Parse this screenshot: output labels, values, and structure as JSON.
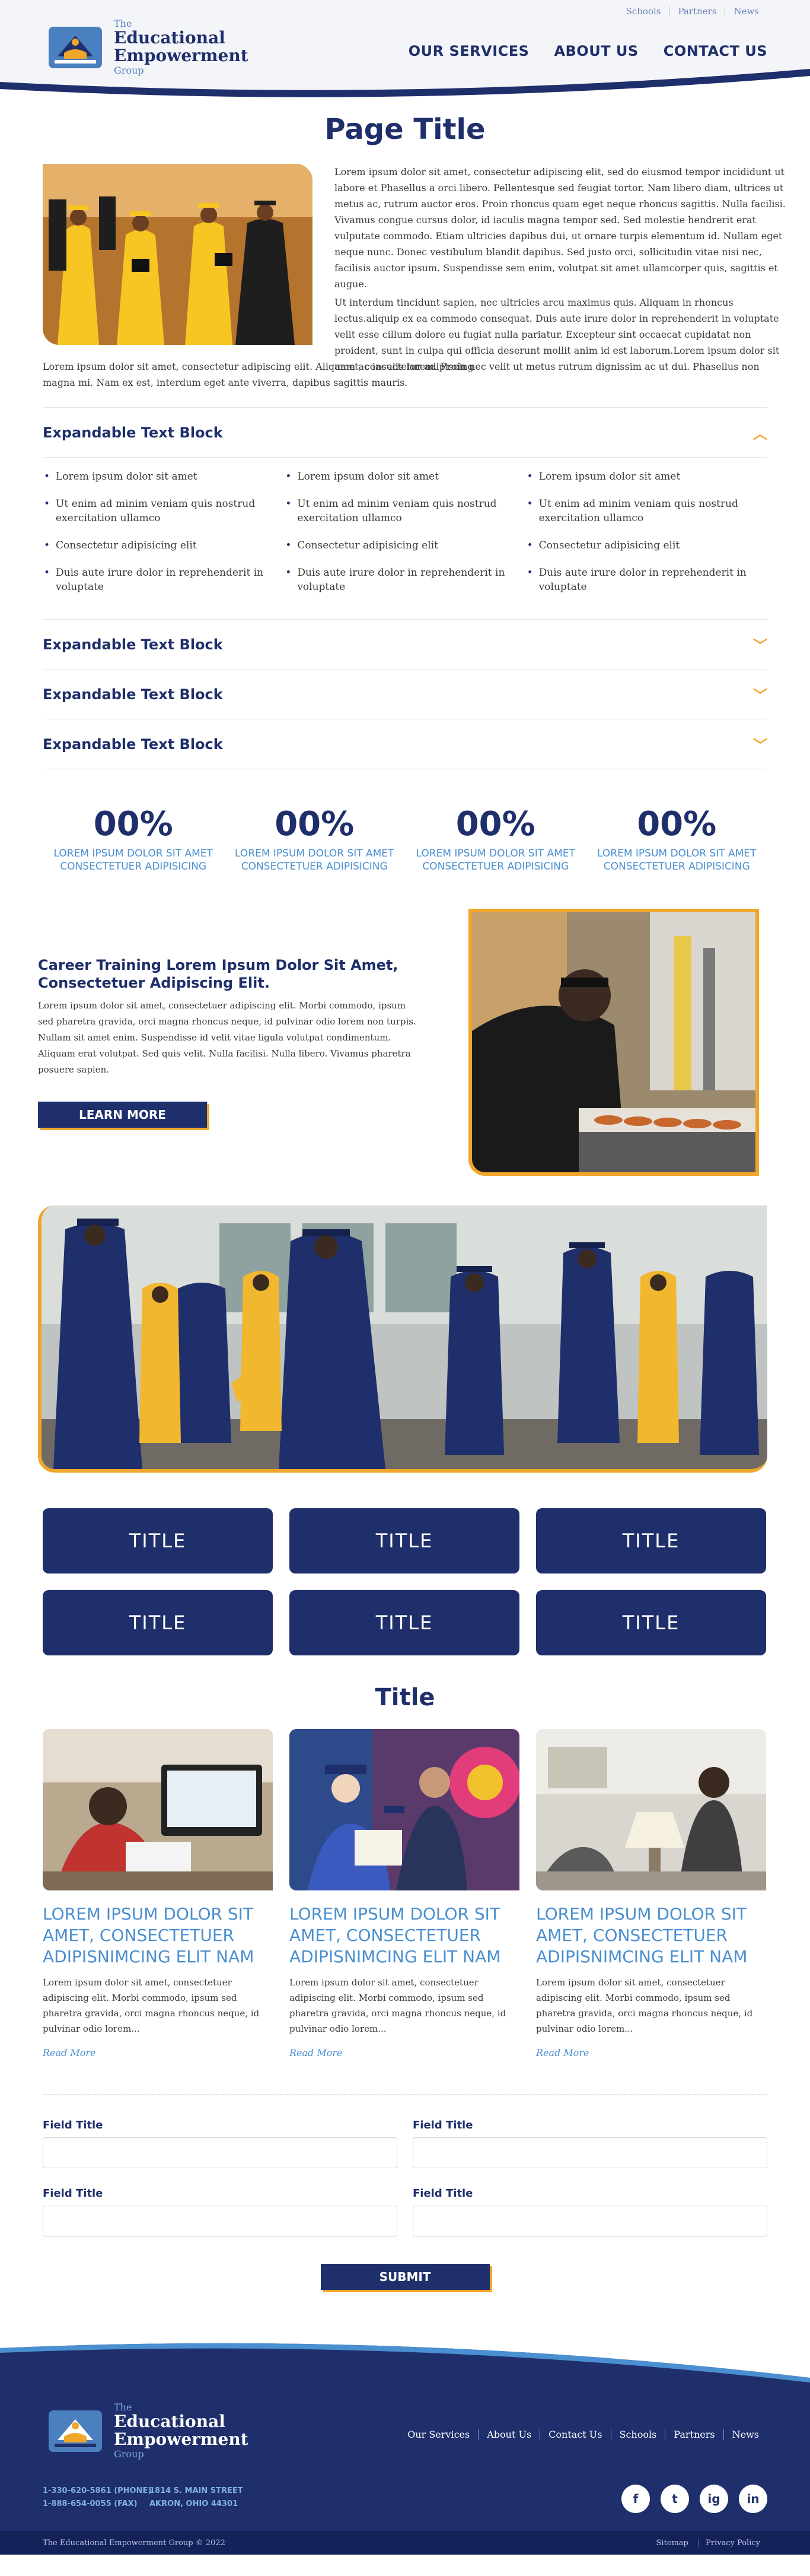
{
  "utility_nav": [
    "Schools",
    "Partners",
    "News"
  ],
  "logo": {
    "line1": "The",
    "line2a": "Educational",
    "line2b": "Empowerment",
    "line3": "Group"
  },
  "main_nav": [
    "OUR SERVICES",
    "ABOUT US",
    "CONTACT US"
  ],
  "page_title": "Page Title",
  "intro": {
    "p1": "Lorem ipsum dolor sit amet, consectetur adipiscing elit, sed do eiusmod tempor incididunt ut labore et Phasellus a orci libero. Pellentesque sed feugiat tortor. Nam libero diam, ultrices ut metus ac, rutrum auctor eros. Proin rhoncus quam eget neque rhoncus sagittis. Nulla facilisi. Vivamus congue cursus dolor, id iaculis magna tempor sed. Sed molestie hendrerit erat vulputate commodo. Etiam ultricies dapibus dui, ut ornare turpis elementum id. Nullam eget neque nunc. Donec vestibulum blandit dapibus. Sed justo orci, sollicitudin vitae nisi nec, facilisis auctor ipsum. Suspendisse sem enim, volutpat sit amet ullamcorper quis, sagittis et augue.",
    "p2": "Ut interdum tincidunt sapien, nec ultricies arcu maximus quis. Aliquam in rhoncus lectus.aliquip ex ea commodo consequat. Duis aute irure dolor in reprehenderit in voluptate velit esse cillum dolore eu fugiat nulla pariatur. Excepteur sint occaecat cupidatat non proident, sunt in culpa qui officia deserunt mollit anim id est laborum.Lorem ipsum dolor sit amet, consectetur adipiscing",
    "p3": "Lorem ipsum dolor sit amet, consectetur adipiscing elit. Aliquam ac iaculis lorem. Proin nec velit ut metus rutrum dignissim ac ut dui. Phasellus non magna mi. Nam ex est, interdum eget ante viverra, dapibus sagittis mauris."
  },
  "accordions": [
    {
      "title": "Expandable Text Block",
      "open": true,
      "columns": [
        [
          "Lorem ipsum dolor sit amet",
          "Ut enim ad minim veniam quis nostrud exercitation ullamco",
          "Consectetur adipisicing elit",
          "Duis aute irure dolor in reprehenderit in voluptate"
        ],
        [
          "Lorem ipsum dolor sit amet",
          "Ut enim ad minim veniam quis nostrud exercitation ullamco",
          "Consectetur adipisicing elit",
          "Duis aute irure dolor in reprehenderit in voluptate"
        ],
        [
          "Lorem ipsum dolor sit amet",
          "Ut enim ad minim veniam quis nostrud exercitation ullamco",
          "Consectetur adipisicing elit",
          "Duis aute irure dolor in reprehenderit in voluptate"
        ]
      ]
    },
    {
      "title": "Expandable Text Block",
      "open": false
    },
    {
      "title": "Expandable Text Block",
      "open": false
    },
    {
      "title": "Expandable Text Block",
      "open": false
    }
  ],
  "stats": [
    {
      "value": "00%",
      "label": "LOREM IPSUM DOLOR SIT AMET CONSECTETUER ADIPISICING"
    },
    {
      "value": "00%",
      "label": "LOREM IPSUM DOLOR SIT AMET CONSECTETUER ADIPISICING"
    },
    {
      "value": "00%",
      "label": "LOREM IPSUM DOLOR SIT AMET CONSECTETUER ADIPISICING"
    },
    {
      "value": "00%",
      "label": "LOREM IPSUM DOLOR SIT AMET CONSECTETUER ADIPISICING"
    }
  ],
  "career": {
    "title": "Career Training Lorem Ipsum Dolor Sit Amet, Consectetuer Adipiscing Elit.",
    "body": "Lorem ipsum dolor sit amet, consectetuer adipiscing elit. Morbi commodo, ipsum sed pharetra gravida, orci magna rhoncus neque, id pulvinar odio lorem non turpis. Nullam sit amet enim. Suspendisse id velit vitae ligula volutpat condimentum. Aliquam erat volutpat. Sed quis velit. Nulla facilisi. Nulla libero. Vivamus pharetra posuere sapien.",
    "button": "LEARN MORE"
  },
  "title_buttons": [
    "TITLE",
    "TITLE",
    "TITLE",
    "TITLE",
    "TITLE",
    "TITLE"
  ],
  "cards_section_title": "Title",
  "cards": [
    {
      "title": "LOREM IPSUM DOLOR SIT AMET, CONSECTETUER ADIPISNIMCING ELIT NAM",
      "body": "Lorem ipsum dolor sit amet, consectetuer adipiscing elit. Morbi commodo, ipsum sed pharetra gravida, orci magna rhoncus neque, id pulvinar odio lorem...",
      "link": "Read More"
    },
    {
      "title": "LOREM IPSUM DOLOR SIT AMET, CONSECTETUER ADIPISNIMCING ELIT NAM",
      "body": "Lorem ipsum dolor sit amet, consectetuer adipiscing elit. Morbi commodo, ipsum sed pharetra gravida, orci magna rhoncus neque, id pulvinar odio lorem...",
      "link": "Read More"
    },
    {
      "title": "LOREM IPSUM DOLOR SIT AMET, CONSECTETUER ADIPISNIMCING ELIT NAM",
      "body": "Lorem ipsum dolor sit amet, consectetuer adipiscing elit. Morbi commodo, ipsum sed pharetra gravida, orci magna rhoncus neque, id pulvinar odio lorem...",
      "link": "Read More"
    }
  ],
  "form": {
    "fields": [
      "Field Title",
      "Field Title",
      "Field Title",
      "Field Title"
    ],
    "submit": "SUBMIT"
  },
  "footer": {
    "links": [
      "Our Services",
      "About Us",
      "Contact Us",
      "Schools",
      "Partners",
      "News"
    ],
    "phone": "1-330-620-5861 (PHONE)",
    "fax": "1-888-654-0055 (FAX)",
    "street": "1814 S. MAIN STREET",
    "city": "AKRON, OHIO 44301",
    "social": [
      "f",
      "t",
      "ig",
      "in"
    ],
    "copyright": "The Educational Empowerment Group © 2022",
    "bottom_links": [
      "Sitemap",
      "Privacy Policy"
    ]
  },
  "colors": {
    "navy": "#1f2f6b",
    "gold": "#f0a62a",
    "accent_blue": "#4a8fd0"
  }
}
